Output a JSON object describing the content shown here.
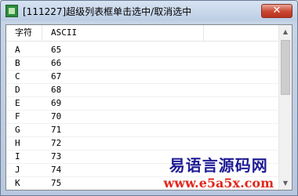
{
  "window": {
    "title": "[111227]超级列表框单击选中/取消选中",
    "close_label": "✕"
  },
  "list": {
    "columns": [
      "字符",
      "ASCII",
      ""
    ],
    "rows": [
      {
        "char": "A",
        "ascii": "65"
      },
      {
        "char": "B",
        "ascii": "66"
      },
      {
        "char": "C",
        "ascii": "67"
      },
      {
        "char": "D",
        "ascii": "68"
      },
      {
        "char": "E",
        "ascii": "69"
      },
      {
        "char": "F",
        "ascii": "70"
      },
      {
        "char": "G",
        "ascii": "71"
      },
      {
        "char": "H",
        "ascii": "72"
      },
      {
        "char": "I",
        "ascii": "73"
      },
      {
        "char": "J",
        "ascii": "74"
      },
      {
        "char": "K",
        "ascii": "75"
      }
    ]
  },
  "watermark": {
    "name": "易语言源码网",
    "url": "www.e5a5x.com"
  }
}
